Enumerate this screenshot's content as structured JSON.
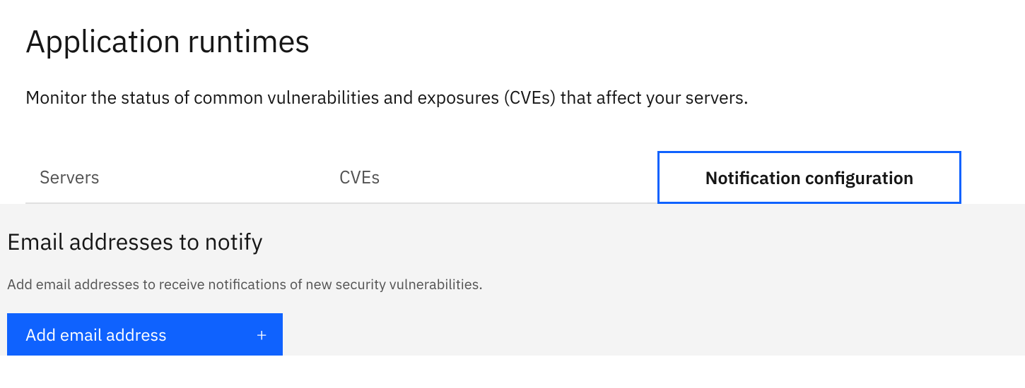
{
  "header": {
    "title": "Application runtimes",
    "subtitle": "Monitor the status of common vulnerabilities and exposures (CVEs) that affect your servers."
  },
  "tabs": {
    "servers": "Servers",
    "cves": "CVEs",
    "notification": "Notification configuration"
  },
  "panel": {
    "title": "Email addresses to notify",
    "subtitle": "Add email addresses to receive notifications of new security vulnerabilities.",
    "add_button_label": "Add email address"
  },
  "colors": {
    "primary": "#0f62fe",
    "panel_bg": "#f4f4f4",
    "text": "#161616",
    "text_secondary": "#525252",
    "tab_border": "#e0e0e0"
  }
}
